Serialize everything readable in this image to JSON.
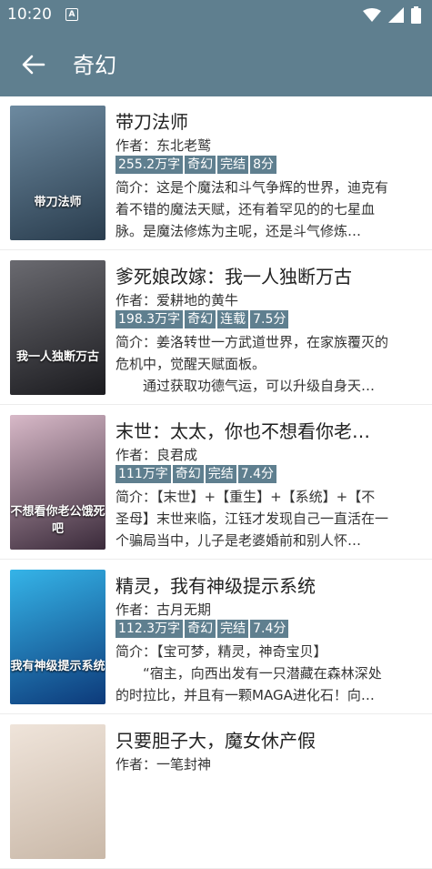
{
  "status": {
    "time": "10:20",
    "notif_letter": "A"
  },
  "appbar": {
    "title": "奇幻"
  },
  "books": [
    {
      "title": "带刀法师",
      "author": "作者：东北老鹫",
      "tags": [
        "255.2万字",
        "奇幻",
        "完结",
        "8分"
      ],
      "intro": "简介：这是个魔法和斗气争辉的世界，迪克有着不错的魔法天赋，还有着罕见的的七星血脉。是魔法修炼为主呢，还是斗气修炼…",
      "cover_text": "带刀法师",
      "cover_colors": [
        "#2a3d4e",
        "#6d8aa0"
      ]
    },
    {
      "title": "爹死娘改嫁：我一人独断万古",
      "author": "作者：爱耕地的黄牛",
      "tags": [
        "198.3万字",
        "奇幻",
        "连载",
        "7.5分"
      ],
      "intro": "简介：姜洛转世一方武道世界，在家族覆灭的危机中，觉醒天赋面板。\n　　通过获取功德气运，可以升级自身天…",
      "cover_text": "我一人独断万古",
      "cover_colors": [
        "#1b1b1f",
        "#6a6a70"
      ]
    },
    {
      "title": "末世：太太，你也不想看你老…",
      "author": "作者：良君成",
      "tags": [
        "111万字",
        "奇幻",
        "完结",
        "7.4分"
      ],
      "intro": "简介：【末世】+【重生】+【系统】+【不圣母】末世来临，江钰才发现自己一直活在一个骗局当中，儿子是老婆婚前和别人怀…",
      "cover_text": "不想看你老公饿死吧",
      "cover_colors": [
        "#3a2a3a",
        "#d8b9c8"
      ]
    },
    {
      "title": "精灵，我有神级提示系统",
      "author": "作者：古月无期",
      "tags": [
        "112.3万字",
        "奇幻",
        "完结",
        "7.4分"
      ],
      "intro": "简介：【宝可梦，精灵，神奇宝贝】\n　　“宿主，向西出发有一只潜藏在森林深处的时拉比，并且有一颗MAGA进化石！向…",
      "cover_text": "我有神级提示系统",
      "cover_colors": [
        "#0d3a7a",
        "#35b4e8"
      ]
    },
    {
      "title": "只要胆子大，魔女休产假",
      "author": "作者：一笔封神",
      "tags": [],
      "intro": "",
      "cover_text": "",
      "cover_colors": [
        "#c9b8a8",
        "#efe4da"
      ]
    }
  ]
}
